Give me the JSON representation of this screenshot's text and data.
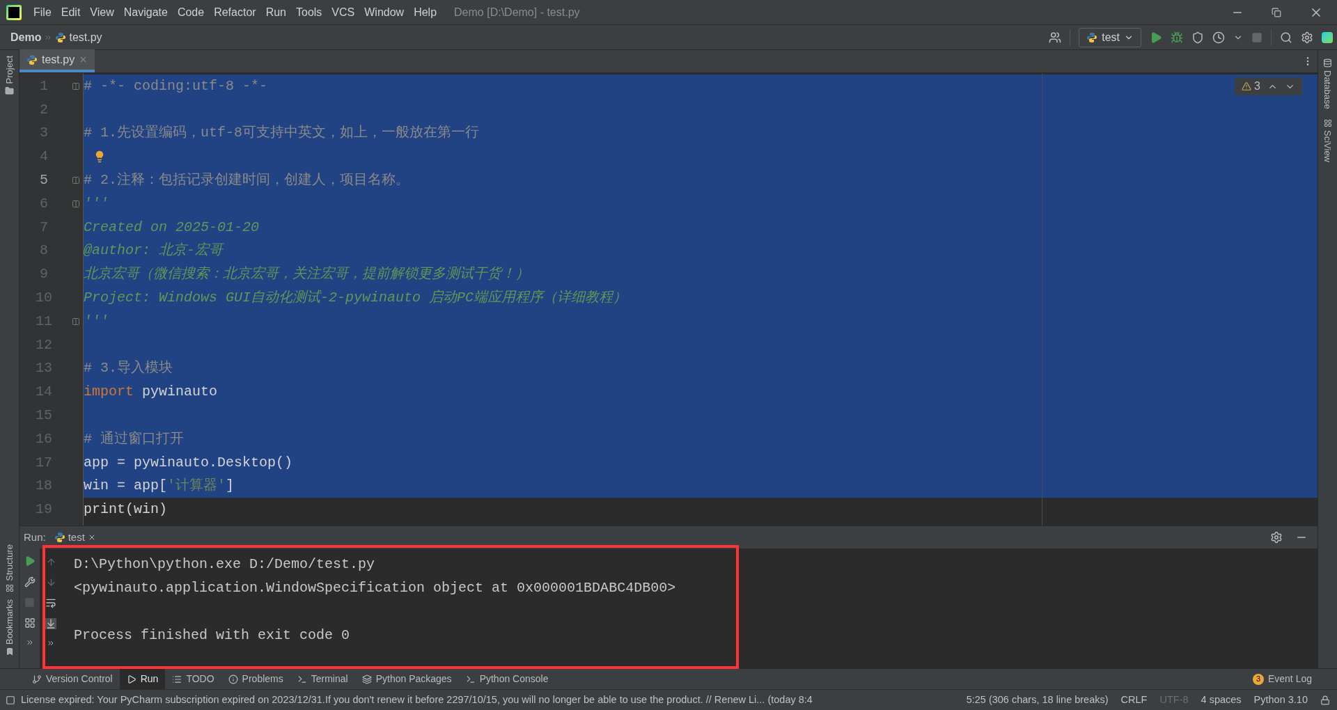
{
  "menu": [
    "File",
    "Edit",
    "View",
    "Navigate",
    "Code",
    "Refactor",
    "Run",
    "Tools",
    "VCS",
    "Window",
    "Help"
  ],
  "window": {
    "title": "Demo [D:\\Demo] - test.py"
  },
  "breadcrumb": [
    "Demo",
    "test.py"
  ],
  "run_config": "test",
  "left_strip": [
    "Project",
    "Structure",
    "Bookmarks"
  ],
  "right_strip": [
    "Database",
    "SciView"
  ],
  "editor_tabs": [
    {
      "label": "test.py",
      "selected": true
    }
  ],
  "warnings": "3",
  "lines": [
    {
      "number": "1",
      "current": false,
      "selected": true,
      "kind": "fold",
      "tokens": [
        {
          "kind": "comment",
          "text": "# -*- coding:utf-8 -*-"
        }
      ]
    },
    {
      "number": "2",
      "current": false,
      "selected": true,
      "kind": "plain"
    },
    {
      "number": "3",
      "current": false,
      "selected": true,
      "kind": "plain",
      "tokens": [
        {
          "kind": "comment",
          "text": "# 1.先设置编码，utf-8可支持中英文，如上，一般放在第一行"
        }
      ]
    },
    {
      "number": "4",
      "current": false,
      "selected": true,
      "kind": "bulb"
    },
    {
      "number": "5",
      "current": true,
      "selected": true,
      "kind": "fold",
      "tokens": [
        {
          "kind": "comment",
          "text": "# 2.注释：包括记录创建时间，创建人，项目名称。"
        }
      ]
    },
    {
      "number": "6",
      "current": false,
      "selected": true,
      "kind": "fold",
      "tokens": [
        {
          "kind": "doc",
          "text": "'''"
        }
      ]
    },
    {
      "number": "7",
      "current": false,
      "selected": true,
      "kind": "plain",
      "tokens": [
        {
          "kind": "doc",
          "text": "Created on 2025-01-20"
        }
      ]
    },
    {
      "number": "8",
      "current": false,
      "selected": true,
      "kind": "plain",
      "tokens": [
        {
          "kind": "doc",
          "text": "@author: 北京-宏哥"
        }
      ]
    },
    {
      "number": "9",
      "current": false,
      "selected": true,
      "kind": "plain",
      "tokens": [
        {
          "kind": "doc",
          "text": "北京宏哥（微信搜索：北京宏哥，关注宏哥，提前解锁更多测试干货！）"
        }
      ]
    },
    {
      "number": "10",
      "current": false,
      "selected": true,
      "kind": "plain",
      "tokens": [
        {
          "kind": "doc",
          "text": "Project: Windows GUI自动化测试-2-pywinauto 启动PC端应用程序（详细教程）"
        }
      ]
    },
    {
      "number": "11",
      "current": false,
      "selected": true,
      "kind": "fold",
      "tokens": [
        {
          "kind": "doc",
          "text": "'''"
        }
      ]
    },
    {
      "number": "12",
      "current": false,
      "selected": true,
      "kind": "plain"
    },
    {
      "number": "13",
      "current": false,
      "selected": true,
      "kind": "plain",
      "tokens": [
        {
          "kind": "comment",
          "text": "# 3.导入模块"
        }
      ]
    },
    {
      "number": "14",
      "current": false,
      "selected": true,
      "kind": "plain",
      "tokens": [
        {
          "kind": "keyword",
          "text": "import"
        },
        {
          "kind": "plain",
          "text": " pywinauto"
        }
      ]
    },
    {
      "number": "15",
      "current": false,
      "selected": true,
      "kind": "plain"
    },
    {
      "number": "16",
      "current": false,
      "selected": true,
      "kind": "plain",
      "tokens": [
        {
          "kind": "comment",
          "text": "# 通过窗口打开"
        }
      ]
    },
    {
      "number": "17",
      "current": false,
      "selected": true,
      "kind": "plain",
      "tokens": [
        {
          "kind": "plain",
          "text": "app = pywinauto.Desktop()"
        }
      ]
    },
    {
      "number": "18",
      "current": false,
      "selected": true,
      "kind": "plain",
      "tokens": [
        {
          "kind": "plain",
          "text": "win = app["
        },
        {
          "kind": "string",
          "text": "'计算器'"
        },
        {
          "kind": "plain",
          "text": "]"
        }
      ]
    },
    {
      "number": "19",
      "current": false,
      "selected": false,
      "kind": "plain",
      "tokens": [
        {
          "kind": "plain",
          "text": "print(win)"
        }
      ]
    }
  ],
  "run_panel": {
    "label": "Run:",
    "tab": "test",
    "console": [
      {
        "kind": "output",
        "text": "D:\\Python\\python.exe D:/Demo/test.py"
      },
      {
        "kind": "output",
        "text": "<pywinauto.application.WindowSpecification object at 0x000001BDABC4DB00>"
      },
      {
        "kind": "blank"
      },
      {
        "kind": "output",
        "text": "Process finished with exit code 0"
      }
    ]
  },
  "tool_tabs": [
    {
      "label": "Version Control",
      "selected": false
    },
    {
      "label": "Run",
      "selected": true
    },
    {
      "label": "TODO",
      "selected": false
    },
    {
      "label": "Problems",
      "selected": false
    },
    {
      "label": "Terminal",
      "selected": false
    },
    {
      "label": "Python Packages",
      "selected": false
    },
    {
      "label": "Python Console",
      "selected": false
    }
  ],
  "event_log": {
    "label": "Event Log",
    "count": "3"
  },
  "status": {
    "message": "License expired: Your PyCharm subscription expired on 2023/12/31.If you don't renew it before 2297/10/15, you will no longer be able to use the product. // Renew Li... (today 8:4",
    "items": [
      {
        "text": "5:25 (306 chars, 18 line breaks)",
        "disabled": false
      },
      {
        "text": "CRLF",
        "disabled": false
      },
      {
        "text": "UTF-8",
        "disabled": true
      },
      {
        "text": "4 spaces",
        "disabled": false
      },
      {
        "text": "Python 3.10",
        "disabled": false
      }
    ]
  }
}
